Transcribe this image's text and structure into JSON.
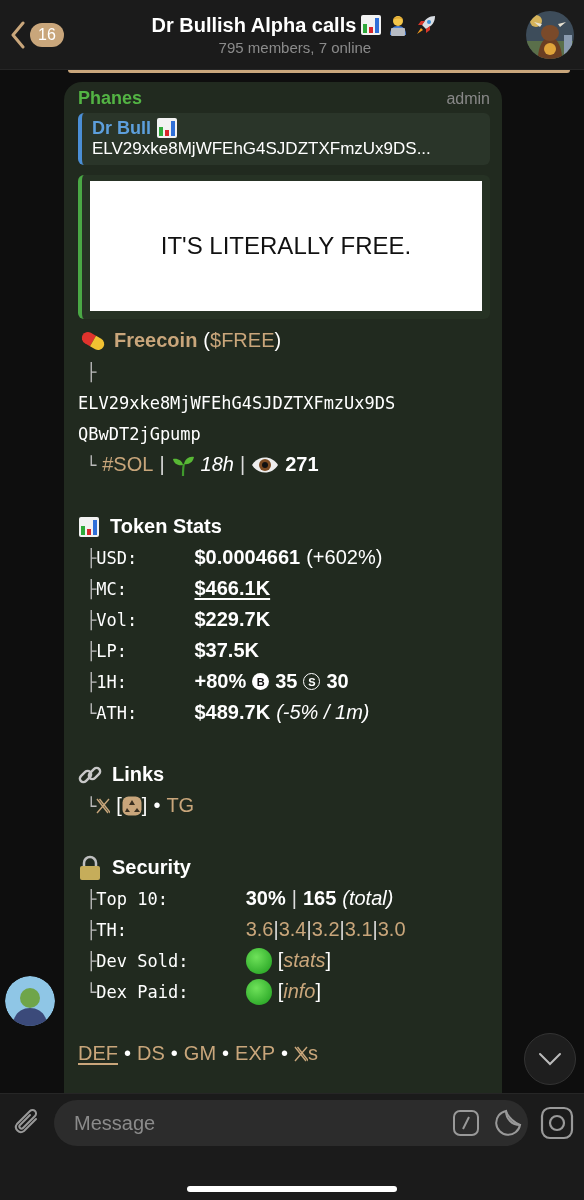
{
  "header": {
    "back_count": "16",
    "title": "Dr Bullish Alpha calls",
    "subtitle": "795 members, 7 online"
  },
  "message": {
    "sender": "Phanes",
    "role": "admin",
    "reply": {
      "author": "Dr Bull",
      "text": "ELV29xke8MjWFEhG4SJDZTXFmzUx9DS..."
    },
    "preview": {
      "text": "IT'S LITERALLY FREE."
    },
    "token": {
      "name": "Freecoin",
      "ticker_open": "(",
      "ticker": "$FREE",
      "ticker_close": ")",
      "branch": "├",
      "address": [
        "ELV29xke8MjWFEhG4SJDZTXFmzUx9DS",
        "QBwDT2jGpump"
      ],
      "end_branch": "└",
      "chain": "#SOL",
      "separator": "|",
      "age": "18h",
      "separator_2": "|",
      "views": "271"
    },
    "sections": [
      {
        "kind": "stats",
        "title": "Token Stats",
        "rows": [
          {
            "branch": "├",
            "label": "USD:",
            "parts": [
              {
                "kind": "bold",
                "text": "$0.0004661"
              },
              {
                "kind": "light",
                "text": "(+602%)"
              }
            ]
          },
          {
            "branch": "├",
            "label": "MC:",
            "parts": [
              {
                "kind": "bold_link",
                "text": "$466.1K"
              }
            ]
          },
          {
            "branch": "├",
            "label": "Vol:",
            "parts": [
              {
                "kind": "bold",
                "text": "$229.7K"
              }
            ]
          },
          {
            "branch": "├",
            "label": "LP:",
            "parts": [
              {
                "kind": "bold",
                "text": "$37.5K"
              }
            ]
          },
          {
            "branch": "├",
            "label": "1H:",
            "parts": [
              {
                "kind": "bold",
                "text": "+80%"
              },
              {
                "kind": "buy_badge",
                "text": "B"
              },
              {
                "kind": "bold",
                "text": "35"
              },
              {
                "kind": "sell_badge",
                "text": "S"
              },
              {
                "kind": "bold",
                "text": "30"
              }
            ]
          },
          {
            "branch": "└",
            "label": "ATH:",
            "parts": [
              {
                "kind": "bold",
                "text": "$489.7K"
              },
              {
                "kind": "italic",
                "text": "(-5% / 1m)"
              }
            ]
          }
        ]
      },
      {
        "kind": "links",
        "title": "Links",
        "rows": [
          {
            "branch": "└",
            "parts": [
              {
                "kind": "x_icon"
              },
              {
                "kind": "bracket_open",
                "text": "["
              },
              {
                "kind": "recycle_icon"
              },
              {
                "kind": "bracket_close",
                "text": "]"
              },
              {
                "kind": "dot_sep",
                "text": "•"
              },
              {
                "kind": "gold_link",
                "text": "TG"
              }
            ]
          }
        ]
      },
      {
        "kind": "security",
        "title": "Security",
        "rows": [
          {
            "branch": "├",
            "label": "Top 10:",
            "parts": [
              {
                "kind": "bold",
                "text": "30%"
              },
              {
                "kind": "sep",
                "text": "|"
              },
              {
                "kind": "bold",
                "text": "165"
              },
              {
                "kind": "italic",
                "text": "(total)"
              }
            ]
          },
          {
            "branch": "├",
            "label": "TH:",
            "parts": [
              {
                "kind": "gold",
                "text": "3.6"
              },
              {
                "kind": "tight_sep",
                "text": "|"
              },
              {
                "kind": "gold",
                "text": "3.4"
              },
              {
                "kind": "tight_sep",
                "text": "|"
              },
              {
                "kind": "gold",
                "text": "3.2"
              },
              {
                "kind": "tight_sep",
                "text": "|"
              },
              {
                "kind": "gold",
                "text": "3.1"
              },
              {
                "kind": "tight_sep",
                "text": "|"
              },
              {
                "kind": "gold",
                "text": "3.0"
              }
            ]
          },
          {
            "branch": "├",
            "label": "Dev Sold:",
            "parts": [
              {
                "kind": "status_dot"
              },
              {
                "kind": "bracket_open",
                "text": "["
              },
              {
                "kind": "gold_italic_link",
                "text": "stats"
              },
              {
                "kind": "bracket_close",
                "text": "]"
              }
            ]
          },
          {
            "branch": "└",
            "label": "Dex Paid:",
            "parts": [
              {
                "kind": "status_dot"
              },
              {
                "kind": "bracket_open",
                "text": "["
              },
              {
                "kind": "gold_italic_link",
                "text": "info"
              },
              {
                "kind": "bracket_close",
                "text": "]"
              }
            ]
          }
        ]
      }
    ],
    "footer": [
      {
        "kind": "gold_underline_link",
        "text": "DEF"
      },
      {
        "kind": "dot_sep",
        "text": "•"
      },
      {
        "kind": "gold_link",
        "text": "DS"
      },
      {
        "kind": "dot_sep",
        "text": "•"
      },
      {
        "kind": "gold_link",
        "text": "GM"
      },
      {
        "kind": "dot_sep",
        "text": "•"
      },
      {
        "kind": "gold_link",
        "text": "EXP"
      },
      {
        "kind": "dot_sep",
        "text": "•"
      },
      {
        "kind": "x_icon"
      },
      {
        "kind": "gold_suffix",
        "text": "s"
      }
    ]
  },
  "composer": {
    "placeholder": "Message"
  }
}
